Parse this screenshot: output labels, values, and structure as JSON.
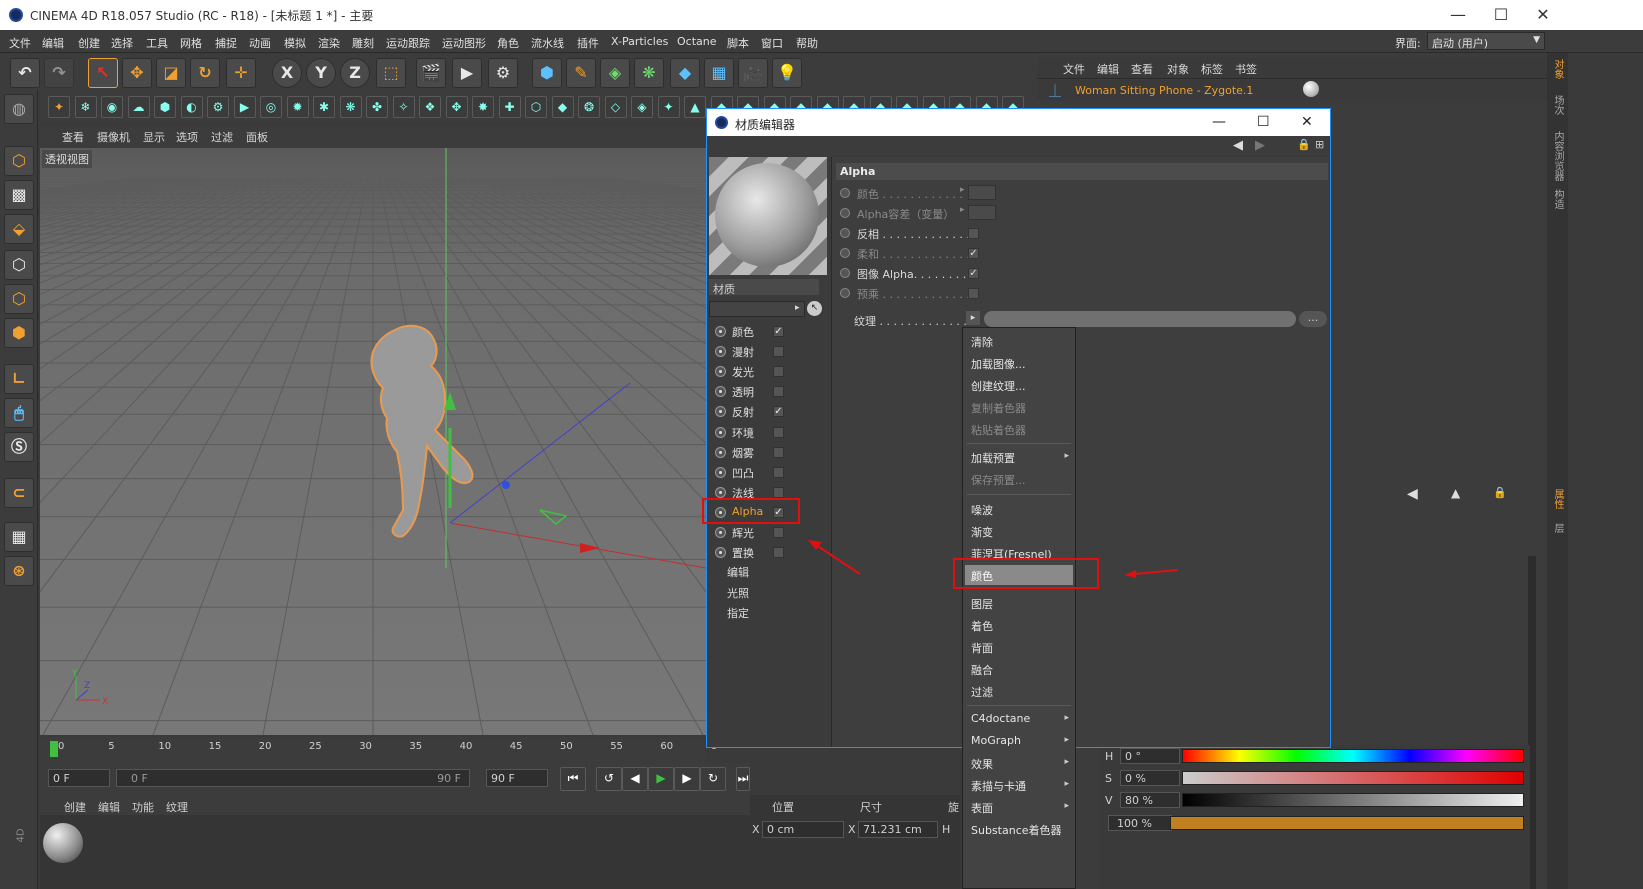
{
  "window": {
    "title": "CINEMA 4D R18.057 Studio (RC - R18) - [未标题 1 *] - 主要",
    "minimize": "—",
    "maximize": "☐",
    "close": "✕"
  },
  "menu": [
    "文件",
    "编辑",
    "创建",
    "选择",
    "工具",
    "网格",
    "捕捉",
    "动画",
    "模拟",
    "渲染",
    "雕刻",
    "运动跟踪",
    "运动图形",
    "角色",
    "流水线",
    "插件",
    "X-Particles",
    "Octane",
    "脚本",
    "窗口",
    "帮助"
  ],
  "layout": {
    "label": "界面:",
    "value": "启动 (用户)"
  },
  "viewport": {
    "menu": [
      "查看",
      "摄像机",
      "显示",
      "选项",
      "过滤",
      "面板"
    ],
    "name": "透视视图",
    "axis": {
      "x": "X",
      "y": "Y",
      "z": "Z"
    }
  },
  "timeline": {
    "ticks": [
      "0",
      "5",
      "10",
      "15",
      "20",
      "25",
      "30",
      "35",
      "40",
      "45",
      "50",
      "55",
      "60",
      "6"
    ],
    "start": "0 F",
    "slider_start": "0 F",
    "slider_end": "90 F",
    "end": "90 F"
  },
  "material_manager": {
    "menu": [
      "创建",
      "编辑",
      "功能",
      "纹理"
    ]
  },
  "coords": {
    "position": "位置",
    "size": "尺寸",
    "rotation": "旋",
    "x_label": "X",
    "x_value": "0 cm",
    "size_x_label": "X",
    "size_x_value": "71.231 cm",
    "h_label": "H"
  },
  "object_manager": {
    "menu": [
      "文件",
      "编辑",
      "查看",
      "对象",
      "标签",
      "书签"
    ],
    "object_name": "Woman Sitting Phone - Zygote.1"
  },
  "side_tabs": [
    "对象",
    "场次",
    "内容浏览器",
    "构造",
    "属性",
    "层"
  ],
  "material_editor": {
    "title": "材质编辑器",
    "minimize": "—",
    "maximize": "☐",
    "close": "✕",
    "material_label": "材质",
    "channels": [
      {
        "label": "颜色",
        "checked": "✓"
      },
      {
        "label": "漫射",
        "checked": ""
      },
      {
        "label": "发光",
        "checked": ""
      },
      {
        "label": "透明",
        "checked": ""
      },
      {
        "label": "反射",
        "checked": "✓"
      },
      {
        "label": "环境",
        "checked": ""
      },
      {
        "label": "烟雾",
        "checked": ""
      },
      {
        "label": "凹凸",
        "checked": ""
      },
      {
        "label": "法线",
        "checked": ""
      },
      {
        "label": "Alpha",
        "checked": "✓"
      },
      {
        "label": "辉光",
        "checked": ""
      },
      {
        "label": "置换",
        "checked": ""
      }
    ],
    "extra": [
      "编辑",
      "光照",
      "指定"
    ],
    "section": "Alpha",
    "props": [
      {
        "label": "颜色 . . . . . . . . . . . .",
        "mark": "▸"
      },
      {
        "label": "Alpha容差（变量）",
        "mark": "▸"
      },
      {
        "label": "反相 . . . . . . . . . . . . . .",
        "checked": ""
      },
      {
        "label": "柔和 . . . . . . . . . . . . . .",
        "checked": "✓"
      },
      {
        "label": "图像 Alpha. . . . . . . . .",
        "checked": "✓"
      },
      {
        "label": "预乘 . . . . . . . . . . . . . .",
        "checked": ""
      }
    ],
    "texture_label": "纹理 . . . . . . . . . . . . . .",
    "texture_button": "..."
  },
  "context_menu": {
    "items": [
      {
        "label": "清除"
      },
      {
        "label": "加载图像..."
      },
      {
        "label": "创建纹理..."
      },
      {
        "label": "复制着色器",
        "disabled": true
      },
      {
        "label": "粘贴着色器",
        "disabled": true
      },
      {
        "label": "加载预置",
        "submenu": "▸"
      },
      {
        "label": "保存预置...",
        "disabled": true
      },
      {
        "label": "噪波"
      },
      {
        "label": "渐变"
      },
      {
        "label": "菲涅耳(Fresnel)"
      },
      {
        "label": "颜色",
        "highlighted": true
      },
      {
        "label": "图层"
      },
      {
        "label": "着色"
      },
      {
        "label": "背面"
      },
      {
        "label": "融合"
      },
      {
        "label": "过滤"
      },
      {
        "label": "C4doctane",
        "submenu": "▸"
      },
      {
        "label": "MoGraph",
        "submenu": "▸"
      },
      {
        "label": "效果",
        "submenu": "▸"
      },
      {
        "label": "素描与卡通",
        "submenu": "▸"
      },
      {
        "label": "表面",
        "submenu": "▸"
      },
      {
        "label": "Substance着色器"
      }
    ]
  },
  "color_picker": {
    "h_label": "H",
    "h_value": "0 °",
    "s_label": "S",
    "s_value": "0 %",
    "v_label": "V",
    "v_value": "80 %",
    "brightness_value": "100 %",
    "colors": {
      "hue": "rainbow",
      "sat_end": "#e00000",
      "val_end": "#f0f0f0"
    }
  },
  "colors": {
    "accent": "#f0a030",
    "highlight_box": "#e01010",
    "dialog_border": "#1e90ff"
  }
}
